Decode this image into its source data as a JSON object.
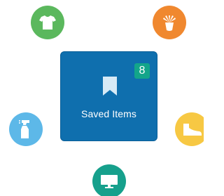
{
  "colors": {
    "card_background": "#0f6fae",
    "badge_background": "#13a58a",
    "bookmark_icon": "#d7eaf6",
    "shirt_circle": "#5bb85d",
    "plant_circle": "#f0882f",
    "spray_circle": "#5db8e8",
    "shoe_circle": "#f7c843",
    "monitor_circle": "#16a08c",
    "icon_white": "#ffffff"
  },
  "card": {
    "label": "Saved Items",
    "badge_count": "8",
    "icon": "bookmark-icon"
  },
  "categories": [
    {
      "icon": "tshirt-icon"
    },
    {
      "icon": "potted-plant-icon"
    },
    {
      "icon": "spray-bottle-icon"
    },
    {
      "icon": "shoe-icon"
    },
    {
      "icon": "monitor-icon"
    }
  ]
}
